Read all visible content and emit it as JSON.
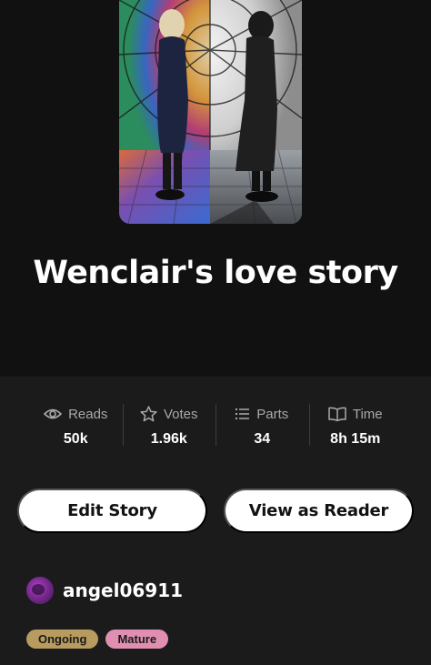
{
  "story": {
    "title": "Wenclair's love story",
    "cover_alt": "Story cover: two figures facing each other before a stained glass window"
  },
  "stats": {
    "reads": {
      "label": "Reads",
      "value": "50k",
      "icon": "eye-icon"
    },
    "votes": {
      "label": "Votes",
      "value": "1.96k",
      "icon": "star-icon"
    },
    "parts": {
      "label": "Parts",
      "value": "34",
      "icon": "list-icon"
    },
    "time": {
      "label": "Time",
      "value": "8h 15m",
      "icon": "book-icon"
    }
  },
  "actions": {
    "edit_label": "Edit Story",
    "reader_label": "View as Reader"
  },
  "author": {
    "username": "angel06911"
  },
  "tags": [
    {
      "label": "Ongoing",
      "color": "#b89b5e"
    },
    {
      "label": "Mature",
      "color": "#e08fb0"
    }
  ],
  "colors": {
    "background": "#1b1b1b",
    "hero_background": "#111111",
    "button_background": "#ffffff"
  }
}
